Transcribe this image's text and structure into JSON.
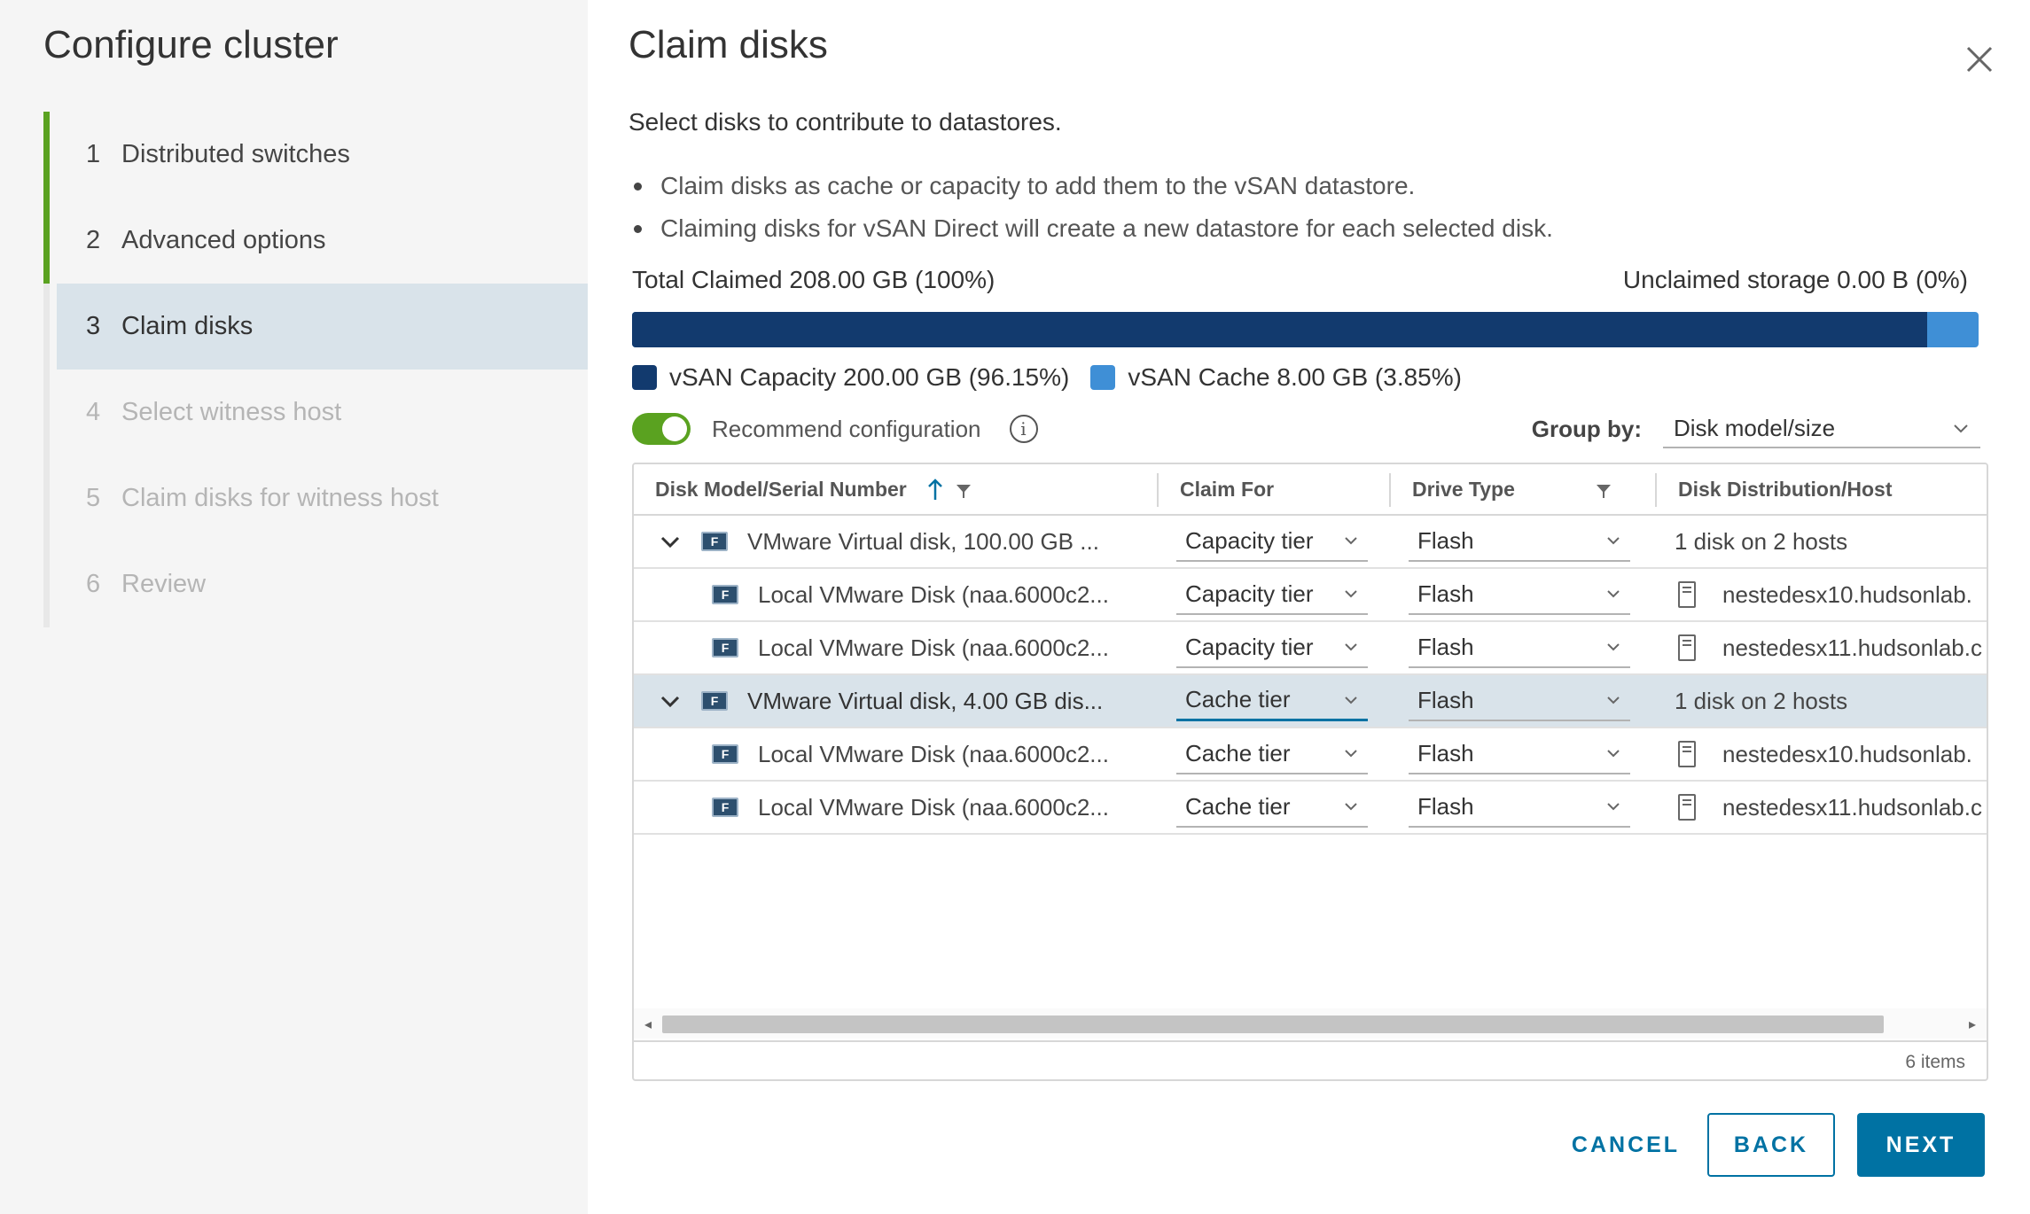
{
  "sidebar": {
    "title": "Configure cluster",
    "steps": [
      {
        "num": "1",
        "label": "Distributed switches"
      },
      {
        "num": "2",
        "label": "Advanced options"
      },
      {
        "num": "3",
        "label": "Claim disks"
      },
      {
        "num": "4",
        "label": "Select witness host"
      },
      {
        "num": "5",
        "label": "Claim disks for witness host"
      },
      {
        "num": "6",
        "label": "Review"
      }
    ]
  },
  "main": {
    "title": "Claim disks",
    "subtitle": "Select disks to contribute to datastores.",
    "bullets": [
      "Claim disks as cache or capacity to add them to the vSAN datastore.",
      "Claiming disks for vSAN Direct will create a new datastore for each selected disk."
    ],
    "total_claimed": "Total Claimed 208.00 GB (100%)",
    "unclaimed": "Unclaimed storage 0.00 B (0%)",
    "capacity_fraction": 0.9615,
    "legend": {
      "capacity": "vSAN Capacity 200.00 GB (96.15%)",
      "cache": "vSAN Cache 8.00 GB (3.85%)"
    },
    "colors": {
      "capacity": "#123a6e",
      "cache": "#3f8fd6",
      "toggle_on": "#5aa220",
      "accent": "#0072a3"
    },
    "recommend_label": "Recommend configuration",
    "groupby_label": "Group by:",
    "groupby_value": "Disk model/size"
  },
  "grid": {
    "headers": {
      "model": "Disk Model/Serial Number",
      "claim": "Claim For",
      "drive": "Drive Type",
      "dist": "Disk Distribution/Host"
    },
    "rows": [
      {
        "model": "VMware Virtual disk, 100.00 GB ...",
        "claim": "Capacity tier",
        "drive": "Flash",
        "dist": "1 disk on 2 hosts"
      },
      {
        "model": "Local VMware Disk (naa.6000c2...",
        "claim": "Capacity tier",
        "drive": "Flash",
        "dist": "nestedesx10.hudsonlab."
      },
      {
        "model": "Local VMware Disk (naa.6000c2...",
        "claim": "Capacity tier",
        "drive": "Flash",
        "dist": "nestedesx11.hudsonlab.c"
      },
      {
        "model": "VMware Virtual disk, 4.00 GB dis...",
        "claim": "Cache tier",
        "drive": "Flash",
        "dist": "1 disk on 2 hosts"
      },
      {
        "model": "Local VMware Disk (naa.6000c2...",
        "claim": "Cache tier",
        "drive": "Flash",
        "dist": "nestedesx10.hudsonlab."
      },
      {
        "model": "Local VMware Disk (naa.6000c2...",
        "claim": "Cache tier",
        "drive": "Flash",
        "dist": "nestedesx11.hudsonlab.c"
      }
    ],
    "disk_icon_letter": "F",
    "footer": "6 items"
  },
  "buttons": {
    "cancel": "CANCEL",
    "back": "BACK",
    "next": "NEXT"
  }
}
